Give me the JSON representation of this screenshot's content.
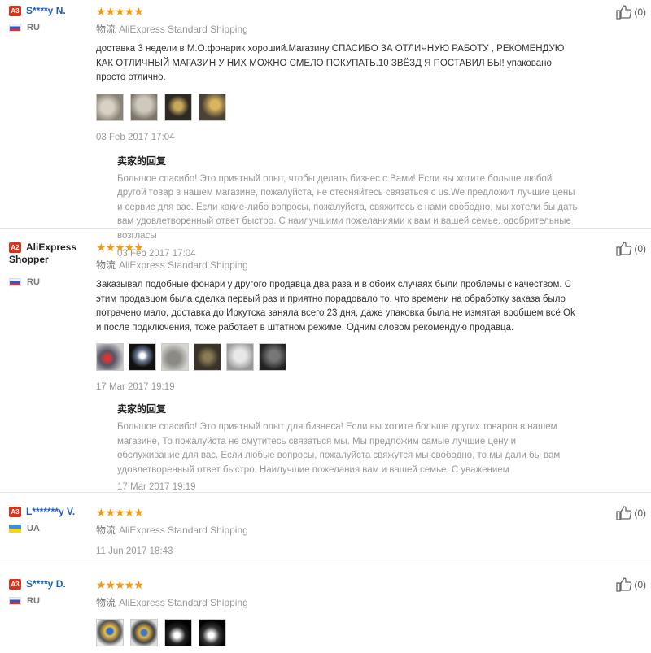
{
  "reviews": [
    {
      "badge": "A3",
      "name": "S****y N.",
      "country": "RU",
      "rating": "★★★★★",
      "logistics": "物流",
      "shipping": "AliExpress Standard Shipping",
      "text": "доставка 3 недели в М.О.фонарик хороший.Магазину СПАСИБО ЗА ОТЛИЧНУЮ РАБОТУ , РЕКОМЕНДУЮ КАК ОТЛИЧНЫЙ МАГАЗИН У НИХ МОЖНО СМЕЛО ПОКУПАТЬ.10 ЗВЁЗД Я ПОСТАВИЛ БЫ! упаковано просто отлично.",
      "date": "03 Feb 2017 17:04",
      "likes": "(0)",
      "reply_title": "卖家的回复",
      "reply_text": "Большое спасибо! Это приятный опыт, чтобы делать бизнес с Вами! Если вы хотите больше любой другой товар в нашем магазине, пожалуйста, не стесняйтесь связаться с us.We предложит лучшие цены и сервис для вас. Если какие-либо вопросы, пожалуйста, свяжитесь с нами свободно, мы хотели бы дать вам удовлетворенный ответ быстро. С наилучшими пожеланиями к вам и вашей семье. одобрительные возгласы",
      "reply_date": "03 Feb 2017 17:04"
    },
    {
      "badge": "A2",
      "name": "AliExpress Shopper",
      "country": "RU",
      "rating": "★★★★★",
      "logistics": "物流",
      "shipping": "AliExpress Standard Shipping",
      "text": "Заказывал подобные фонари у другого продавца два раза и в обоих случаях были проблемы с качеством. С этим продавцом была сделка первый раз и приятно порадовало то, что времени на обработку заказа было потрачено мало, доставка до Иркутска заняла всего 23 дня, даже упаковка была не измятая вообщем всё Ok и после подключения, тоже работает в штатном режиме. Одним словом рекомендую продавца.",
      "date": "17 Mar 2017 19:19",
      "likes": "(0)",
      "reply_title": "卖家的回复",
      "reply_text": "Большое спасибо! Это приятный опыт для бизнеса! Если вы хотите больше других товаров в нашем магазине, То пожалуйста не смутитесь связаться мы. Мы предложим самые лучшие цену и обслуживание для вас. Если любые вопросы, пожалуйста свяжутся мы свободно, то мы дали бы вам удовлетворенный ответ быстро. Наилучшие пожелания вам и вашей семье. С уважением",
      "reply_date": "17 Mar 2017 19:19"
    },
    {
      "badge": "A3",
      "name": "L*******y V.",
      "country": "UA",
      "rating": "★★★★★",
      "logistics": "物流",
      "shipping": "AliExpress Standard Shipping",
      "date": "11 Jun 2017 18:43",
      "likes": "(0)"
    },
    {
      "badge": "A3",
      "name": "S****y D.",
      "country": "RU",
      "rating": "★★★★★",
      "logistics": "物流",
      "shipping": "AliExpress Standard Shipping",
      "likes": "(0)"
    }
  ],
  "colors": {
    "link": "#1b5fb9",
    "star": "#f29a0f",
    "badge": "#d9321e",
    "muted": "#999999"
  },
  "icons": {
    "like": "thumbs-up-icon",
    "flag_ru": "russia-flag-icon",
    "flag_ua": "ukraine-flag-icon"
  }
}
